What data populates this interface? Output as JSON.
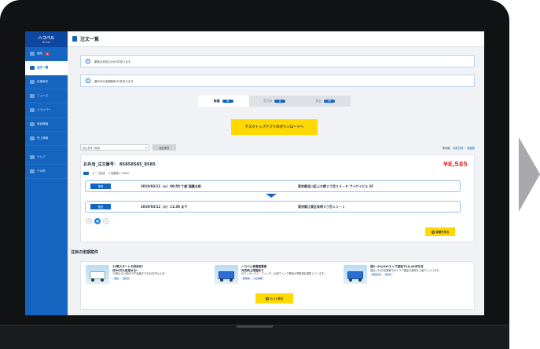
{
  "app": {
    "logo_text": "ハコベル",
    "logo_sub": "Driver",
    "page_title": "注文一覧"
  },
  "sidebar": {
    "items": [
      {
        "label": "通知",
        "badge": "3"
      },
      {
        "label": "注文一覧"
      },
      {
        "label": "定期案件"
      },
      {
        "label": "ニュース"
      },
      {
        "label": "ドライバー"
      },
      {
        "label": "車両情報"
      },
      {
        "label": "売上情報"
      },
      {
        "label": "ヘルプ"
      },
      {
        "label": "その他"
      }
    ]
  },
  "notices": [
    {
      "icon": "!",
      "text": "新着のお知らせが1件あります。"
    },
    {
      "icon": "!",
      "text": "進行中の定期案件が2件あります。"
    }
  ],
  "tabs": [
    {
      "label": "新着",
      "count": "3"
    },
    {
      "label": "受注済",
      "count": "8"
    },
    {
      "label": "過去",
      "count": "99"
    }
  ],
  "download_button": "デスクトップアプリのダウンロードへ",
  "filters": {
    "select_value": "絞込条件で検索",
    "select_arrow": "▾",
    "filter_button": "絞込条件",
    "sort_prefix": "表示順：",
    "sort_option1": "新着日時",
    "sort_sep": "｜",
    "sort_option2": "距離順"
  },
  "order": {
    "customer": "お弁当_注文番号： 85858585_8585",
    "price": "¥8,585",
    "vehicle": "カーゴ指定",
    "info": "2 距離制 / 18km",
    "pickup": {
      "label": "集荷",
      "time": "2019/03/12（火）09:50 丁度 稲葉太郎",
      "address": "東京都品川区上大崎２丁目２４－９ アイケイビル 1F"
    },
    "delivery": {
      "label": "配送",
      "time": "2019/03/12（火）11:30 まで",
      "address": "東京都江東区有明３丁目１１－１"
    },
    "detail_button": "詳細を見る"
  },
  "featured": {
    "section_title": "注目の定期案件",
    "items": [
      {
        "title": "12時スタートの好条件！",
        "title2": "月60万も目指せる!",
        "desc": "12時から14時まで午後稼ぎでも60万円以上可。",
        "tags": [
          "月給",
          "週5日"
        ]
      },
      {
        "title": "ハコベル専属便募集",
        "title2": "月収例上限額あり",
        "desc": "2tワンボックス・ウイング・大型ウイング車両の専属便を募集しています。",
        "tags": [
          "軽貨物",
          "1日単発"
        ]
      },
      {
        "title": "週2~からOK!エリア固定で16,445円/日",
        "title2": "",
        "desc": "週払いも可!定期便でのエリア固定の案件をご紹介しています。",
        "tags": [
          "月給日払",
          "週2日"
        ]
      }
    ],
    "more_button": "もっと見る"
  },
  "colors": {
    "primary": "#1565c0",
    "accent_yellow": "#ffd900",
    "price_red": "#e53935"
  }
}
